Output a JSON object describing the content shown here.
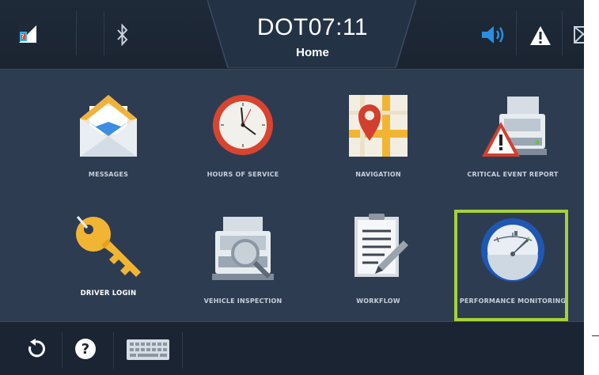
{
  "header": {
    "clock": "DOT07:11",
    "title": "Home",
    "icons": {
      "signal": "cellular-signal-icon",
      "bluetooth": "bluetooth-icon",
      "volume": "volume-icon",
      "alert": "warning-icon",
      "mail": "mail-icon"
    }
  },
  "apps": [
    {
      "label": "MESSAGES",
      "icon": "envelope-icon"
    },
    {
      "label": "HOURS OF SERVICE",
      "icon": "clock-icon"
    },
    {
      "label": "NAVIGATION",
      "icon": "map-pin-icon"
    },
    {
      "label": "CRITICAL EVENT REPORT",
      "icon": "truck-warning-icon"
    },
    {
      "label": "DRIVER LOGIN",
      "icon": "key-icon"
    },
    {
      "label": "VEHICLE INSPECTION",
      "icon": "truck-magnifier-icon"
    },
    {
      "label": "WORKFLOW",
      "icon": "clipboard-pencil-icon"
    },
    {
      "label": "PERFORMANCE MONITORING",
      "icon": "gauge-icon",
      "selected": true
    }
  ],
  "footer": {
    "icons": [
      "refresh-icon",
      "help-icon",
      "keyboard-icon"
    ]
  },
  "colors": {
    "background": "#2e3c51",
    "topbar": "#1f2a39",
    "selection": "#a4d23a",
    "accent_blue": "#2a8fe0"
  }
}
